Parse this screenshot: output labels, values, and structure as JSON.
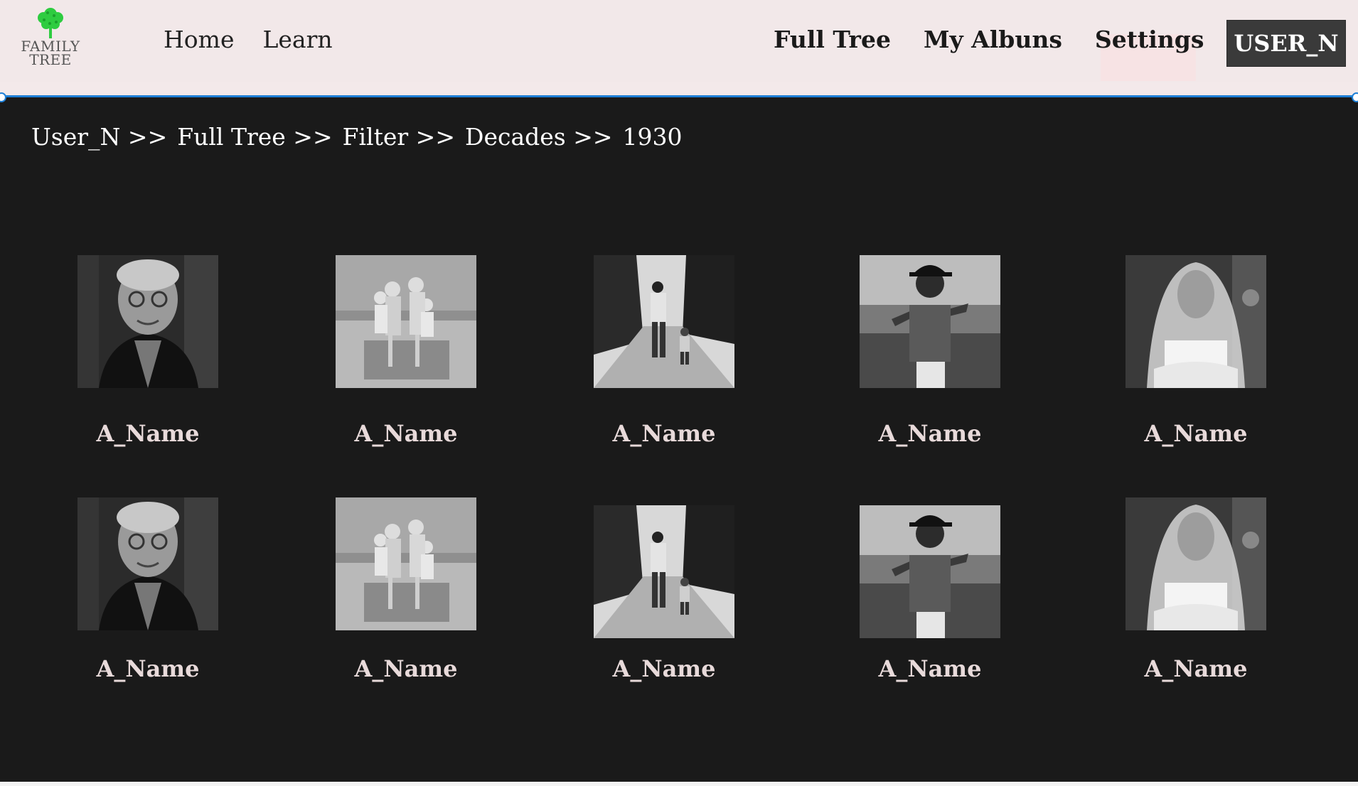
{
  "header": {
    "logo_line1": "FAMILY",
    "logo_line2": "TREE",
    "nav_left": [
      "Home",
      "Learn"
    ],
    "nav_right": [
      "Full Tree",
      "My Albuns",
      "Settings"
    ],
    "user_button": "USER_N"
  },
  "breadcrumb": [
    "User_N >>",
    "Full Tree >>",
    "Filter >>",
    "Decades >>",
    "1930"
  ],
  "gallery": {
    "rows": [
      [
        "A_Name",
        "A_Name",
        "A_Name",
        "A_Name",
        "A_Name"
      ],
      [
        "A_Name",
        "A_Name",
        "A_Name",
        "A_Name",
        "A_Name"
      ]
    ],
    "photo_subjects": [
      "elderly-woman",
      "family-on-beach",
      "father-and-child-walking",
      "boy-with-cap",
      "bride-with-veil"
    ]
  },
  "colors": {
    "header_bg": "#f2e8e9",
    "panel_bg": "#1a1a1a",
    "selection_accent": "#1e7fd6",
    "logo_tree": "#2ecc40",
    "user_button_bg": "#3a3a3a"
  }
}
